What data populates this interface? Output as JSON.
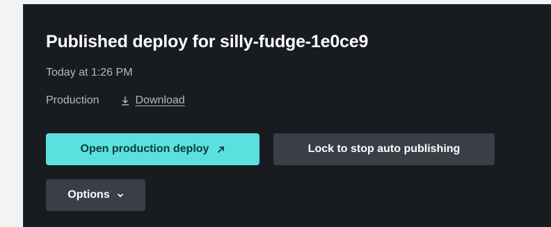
{
  "deploy": {
    "title": "Published deploy for silly-fudge-1e0ce9",
    "timestamp": "Today at 1:26 PM",
    "context": "Production",
    "download_label": "Download",
    "download_icon": "download-icon"
  },
  "actions": {
    "open_label": "Open production deploy",
    "open_icon": "external-arrow-icon",
    "lock_label": "Lock to stop auto publishing",
    "options_label": "Options",
    "options_icon": "chevron-down-icon"
  },
  "colors": {
    "background": "#181b20",
    "primary_button": "#5ae1de",
    "secondary_button": "#3a3f47",
    "title_text": "#ffffff",
    "muted_text": "#b6bac0"
  }
}
